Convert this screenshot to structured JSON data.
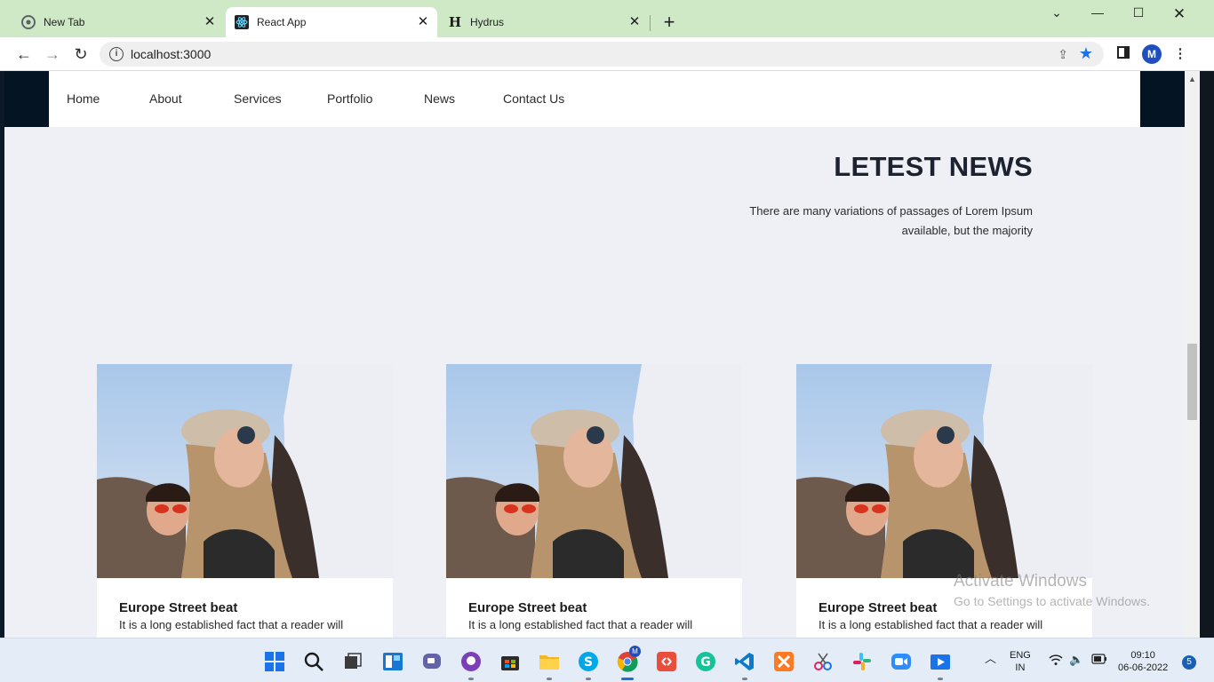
{
  "browser": {
    "tabs": [
      {
        "title": "New Tab"
      },
      {
        "title": "React App"
      },
      {
        "title": "Hydrus"
      }
    ],
    "new_tab_glyph": "+",
    "url": "localhost:3000",
    "profile_initial": "M"
  },
  "site": {
    "nav": [
      "Home",
      "About",
      "Services",
      "Portfolio",
      "News",
      "Contact Us"
    ],
    "section_title": "LETEST NEWS",
    "section_subtitle": "There are many variations of passages of Lorem Ipsum available, but the majority",
    "cards": [
      {
        "title": "Europe Street beat",
        "text": "It is a long established fact that a reader will"
      },
      {
        "title": "Europe Street beat",
        "text": "It is a long established fact that a reader will"
      },
      {
        "title": "Europe Street beat",
        "text": "It is a long established fact that a reader will"
      }
    ]
  },
  "watermark": {
    "line1": "Activate Windows",
    "line2": "Go to Settings to activate Windows."
  },
  "taskbar": {
    "lang_1": "ENG",
    "lang_2": "IN",
    "time": "09:10",
    "date": "06-06-2022",
    "notifications": "5",
    "chrome_badge": "M"
  },
  "colors": {
    "tabstrip": "#cfe9c6",
    "header_band": "#041423",
    "page_bg": "#eef0f5",
    "accent": "#1a73e8"
  }
}
